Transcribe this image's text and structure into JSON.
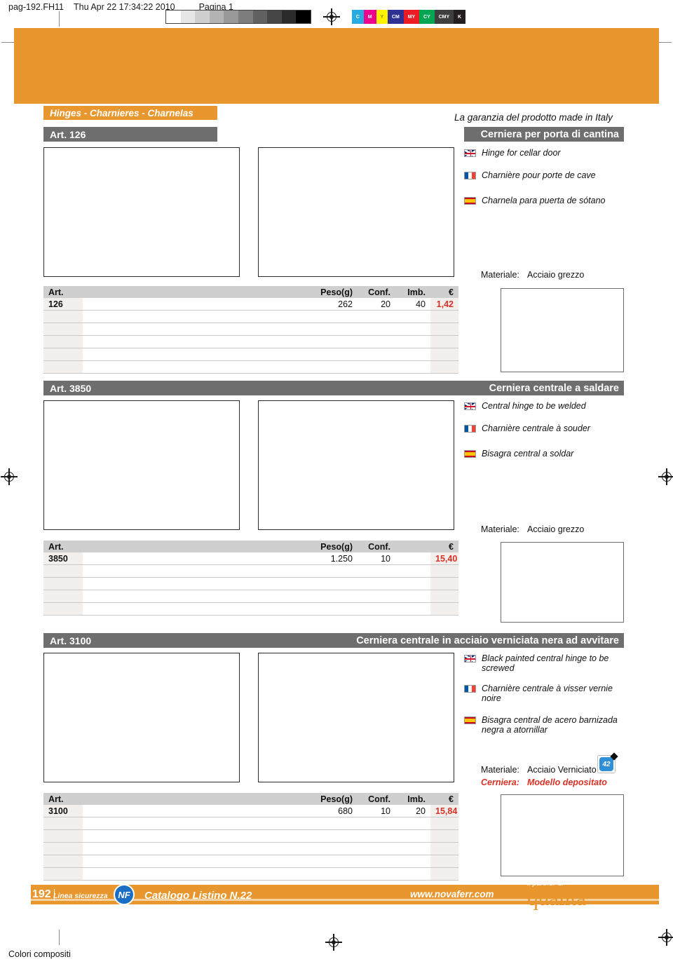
{
  "print_header": {
    "file_name": "pag-192.FH11",
    "timestamp": "Thu Apr 22 17:34:22 2010",
    "page_label": "Pagina 1",
    "color_bar": [
      "C",
      "M",
      "Y",
      "CM",
      "MY",
      "CY",
      "CMY",
      "K"
    ],
    "color_bar_hex": [
      "#29abe2",
      "#ec008c",
      "#fff200",
      "#2e3192",
      "#ed1c24",
      "#00a651",
      "#3f3f3f",
      "#231f20"
    ],
    "gray_ramp_steps": 10
  },
  "category_tab": {
    "label": "Hinges - Charnieres - Charnelas"
  },
  "tagline": "La garanzia del prodotto made in Italy",
  "sections": [
    {
      "art_label": "Art. 126",
      "title": "Cerniera per porta di cantina",
      "translations": [
        {
          "flag": "uk-flag-icon",
          "text": "Hinge for cellar door"
        },
        {
          "flag": "france-flag-icon",
          "text": "Charnière pour porte de cave"
        },
        {
          "flag": "spain-flag-icon",
          "text": "Charnela para puerta de sótano"
        }
      ],
      "materiale_label": "Materiale:",
      "materiale_value": "Acciaio grezzo",
      "table": {
        "headers": [
          "Art.",
          "Peso(g)",
          "Conf.",
          "Imb.",
          "€"
        ],
        "rows": [
          {
            "art": "126",
            "peso": "262",
            "conf": "20",
            "imb": "40",
            "prezzo": "1,42"
          }
        ],
        "empty_rows": 5
      }
    },
    {
      "art_label": "Art. 3850",
      "title": "Cerniera centrale a saldare",
      "translations": [
        {
          "flag": "uk-flag-icon",
          "text": "Central hinge to be welded"
        },
        {
          "flag": "france-flag-icon",
          "text": "Charnière centrale à souder"
        },
        {
          "flag": "spain-flag-icon",
          "text": "Bisagra central a soldar"
        }
      ],
      "materiale_label": "Materiale:",
      "materiale_value": "Acciaio grezzo",
      "table": {
        "headers": [
          "Art.",
          "Peso(g)",
          "Conf.",
          "€"
        ],
        "rows": [
          {
            "art": "3850",
            "peso": "1.250",
            "conf": "10",
            "prezzo": "15,40"
          }
        ],
        "empty_rows": 4
      }
    },
    {
      "art_label": "Art. 3100",
      "title": "Cerniera centrale in acciaio verniciata nera ad avvitare",
      "translations": [
        {
          "flag": "uk-flag-icon",
          "text": "Black painted central hinge to be screwed"
        },
        {
          "flag": "france-flag-icon",
          "text": "Charnière centrale à visser vernie noire"
        },
        {
          "flag": "spain-flag-icon",
          "text": "Bisagra central de acero barnizada negra a atornillar"
        }
      ],
      "materiale_label": "Materiale:",
      "materiale_value": "Acciaio Verniciato",
      "cerniera_label": "Cerniera:",
      "cerniera_value": "Modello depositato",
      "badge_text": "42",
      "table": {
        "headers": [
          "Art.",
          "Peso(g)",
          "Conf.",
          "Imb.",
          "€"
        ],
        "rows": [
          {
            "art": "3100",
            "peso": "680",
            "conf": "10",
            "imb": "20",
            "prezzo": "15,84"
          }
        ],
        "empty_rows": 5
      }
    }
  ],
  "footer": {
    "page_number": "192",
    "linea": "Linea sicurezza",
    "nf_logo": "NF",
    "catalogo": "Catalogo Listino N.22",
    "website": "www.novaferr.com",
    "qualita_top": "il partner di",
    "qualita_big": "qualità"
  },
  "bottom_note": "Colori compositi",
  "colors": {
    "orange": "#e8972e",
    "gray_bar": "#6e6e6e",
    "price_red": "#d93025",
    "table_header": "#cfcfcf"
  }
}
